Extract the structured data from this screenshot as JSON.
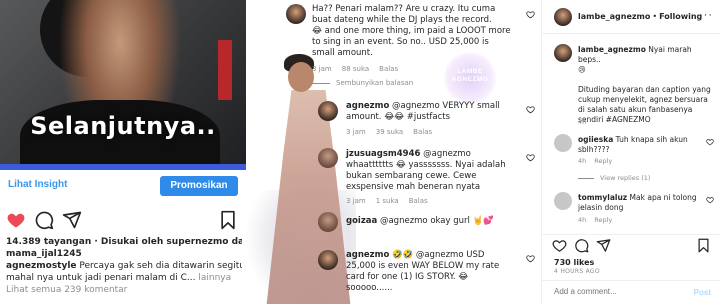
{
  "colors": {
    "accent": "#3897f0",
    "promote": "#2f8be9",
    "heart": "#ed4956",
    "muted": "#8e8e8e"
  },
  "panel1": {
    "overlay_text": "Selanjutnya..",
    "progress": 1.0,
    "insight_label": "Lihat Insight",
    "promote_label": "Promosikan",
    "views_line": "14.389 tayangan · Disukai oleh supernezmo dan",
    "views_line2": "mama_ijal1245",
    "caption_user": "agnezmostyle",
    "caption_text": " Percaya gak seh dia ditawarin segitu",
    "caption_line2": "mahal nya untuk  jadi penari malam di C... ",
    "more_label": "lainnya",
    "view_comments": "Lihat semua 239 komentar"
  },
  "panel2": {
    "watermark": "LAMBE\nAGNEZMO",
    "c1_body": "Ha?? Penari malam?? Are u crazy. Itu cuma buat dateng while the DJ plays the record.",
    "c1_body2": "😂 and one more thing, im paid a LOOOT more to sing in an event. So no.. USD 25,000 is small amount.",
    "c1_time": "3 jam",
    "c1_likes": "88 suka",
    "c1_reply": "Balas",
    "hide_replies": "Sembunyikan balasan",
    "c2_user": "agnezmo",
    "c2_text": " @agnezmo VERYYY small amount. 😂😂 #justfacts",
    "c2_time": "3 jam",
    "c2_likes": "39 suka",
    "c2_reply": "Balas",
    "c3_user": "jzusuagsm4946",
    "c3_text": " @agnezmo whaatttttts 😂 yasssssss. Nyai adalah bukan sembarang cewe. Cewe exspensive mah beneran nyata",
    "c3_time": "3 jam",
    "c3_likes": "1 suka",
    "c3_reply": "Balas",
    "c4_user": "goizaa",
    "c4_text": " @agnezmo okay gurl 🤘💕",
    "c5_user": "agnezmo",
    "c5_text": " 🤣🤣 @agnezmo USD 25,000 is even WAY BELOW my rate card for one (1) IG STORY. 😂 sooooo......"
  },
  "panel3": {
    "header_user": "lambe_agnezmo",
    "header_sep": "•",
    "header_follow": "Following",
    "more_icon": "···",
    "cap_user": "lambe_agnezmo",
    "cap_text": " Nyai marah beps..",
    "cap_emoji": "😢",
    "cap_body": "Dituding bayaran dan caption yang cukup menyelekit, agnez bersuara di salah satu akun fanbasenya sendiri #AGNEZMO",
    "cap_time": "4h",
    "r1_user": "ogiieska",
    "r1_text": " Tuh knapa sih akun sblh????",
    "r1_time": "4h",
    "r1_reply": "Reply",
    "r1_view": "View replies (1)",
    "r2_user": "tommylaluz",
    "r2_text": " Mak apa ni tolong jelasin dong",
    "r2_time": "4h",
    "r2_reply": "Reply",
    "likes": "730 likes",
    "time_ago": "4 HOURS AGO",
    "add_placeholder": "Add a comment...",
    "post_label": "Post"
  }
}
